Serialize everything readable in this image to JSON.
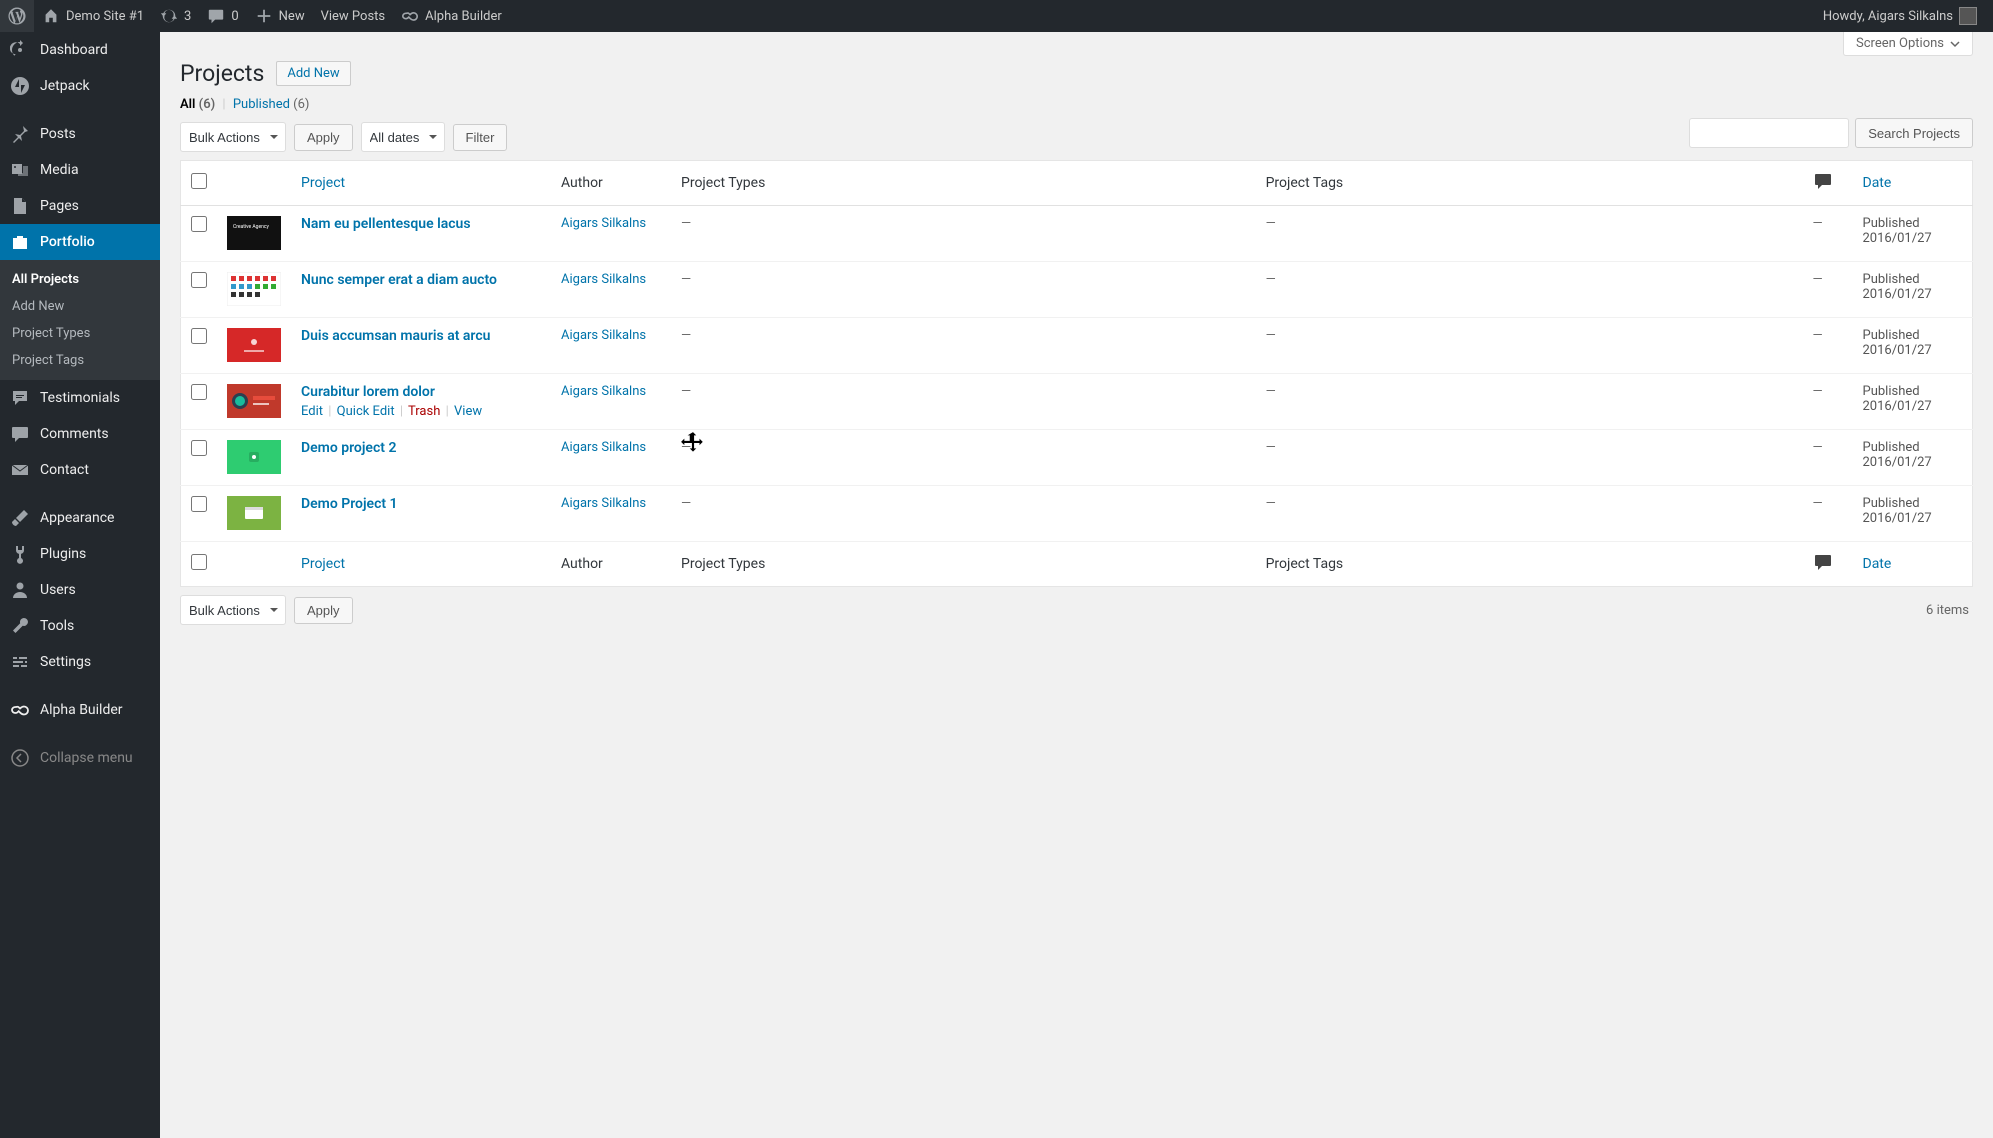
{
  "adminbar": {
    "site_name": "Demo Site #1",
    "updates": "3",
    "comments": "0",
    "new": "New",
    "view_posts": "View Posts",
    "alpha_builder": "Alpha Builder",
    "howdy": "Howdy, Aigars Silkalns"
  },
  "sidebar": {
    "items": [
      {
        "label": "Dashboard",
        "icon": "dashboard"
      },
      {
        "label": "Jetpack",
        "icon": "jetpack"
      },
      {
        "label": "Posts",
        "icon": "pin"
      },
      {
        "label": "Media",
        "icon": "media"
      },
      {
        "label": "Pages",
        "icon": "page"
      },
      {
        "label": "Portfolio",
        "icon": "portfolio",
        "current": true
      },
      {
        "label": "Testimonials",
        "icon": "testimonial"
      },
      {
        "label": "Comments",
        "icon": "comment"
      },
      {
        "label": "Contact",
        "icon": "mail"
      },
      {
        "label": "Appearance",
        "icon": "brush"
      },
      {
        "label": "Plugins",
        "icon": "plug"
      },
      {
        "label": "Users",
        "icon": "user"
      },
      {
        "label": "Tools",
        "icon": "wrench"
      },
      {
        "label": "Settings",
        "icon": "sliders"
      },
      {
        "label": "Alpha Builder",
        "icon": "alpha"
      }
    ],
    "submenu": [
      {
        "label": "All Projects",
        "current": true
      },
      {
        "label": "Add New"
      },
      {
        "label": "Project Types"
      },
      {
        "label": "Project Tags"
      }
    ],
    "collapse": "Collapse menu"
  },
  "page": {
    "screen_options": "Screen Options",
    "title": "Projects",
    "add_new": "Add New",
    "filters": {
      "all": "All",
      "all_count": "(6)",
      "published": "Published",
      "published_count": "(6)"
    },
    "bulk_actions": "Bulk Actions",
    "apply": "Apply",
    "all_dates": "All dates",
    "filter": "Filter",
    "items_count": "6 items",
    "search_button": "Search Projects"
  },
  "table": {
    "headers": {
      "project": "Project",
      "author": "Author",
      "types": "Project Types",
      "tags": "Project Tags",
      "date": "Date"
    },
    "row_actions": {
      "edit": "Edit",
      "quick": "Quick Edit",
      "trash": "Trash",
      "view": "View"
    },
    "rows": [
      {
        "title": "Nam eu pellentesque lacus",
        "author": "Aigars Silkalns",
        "types": "—",
        "tags": "—",
        "comments": "—",
        "date_status": "Published",
        "date": "2016/01/27",
        "thumb": "black"
      },
      {
        "title": "Nunc semper erat a diam aucto",
        "author": "Aigars Silkalns",
        "types": "—",
        "tags": "—",
        "comments": "—",
        "date_status": "Published",
        "date": "2016/01/27",
        "thumb": "grid"
      },
      {
        "title": "Duis accumsan mauris at arcu",
        "author": "Aigars Silkalns",
        "types": "—",
        "tags": "—",
        "comments": "—",
        "date_status": "Published",
        "date": "2016/01/27",
        "thumb": "red"
      },
      {
        "title": "Curabitur lorem dolor",
        "author": "Aigars Silkalns",
        "types": "—",
        "tags": "—",
        "comments": "—",
        "date_status": "Published",
        "date": "2016/01/27",
        "thumb": "redcircle",
        "hovered": true
      },
      {
        "title": "Demo project 2",
        "author": "Aigars Silkalns",
        "types": "—",
        "tags": "—",
        "comments": "—",
        "date_status": "Published",
        "date": "2016/01/27",
        "thumb": "green1"
      },
      {
        "title": "Demo Project 1",
        "author": "Aigars Silkalns",
        "types": "—",
        "tags": "—",
        "comments": "—",
        "date_status": "Published",
        "date": "2016/01/27",
        "thumb": "green2"
      }
    ]
  }
}
